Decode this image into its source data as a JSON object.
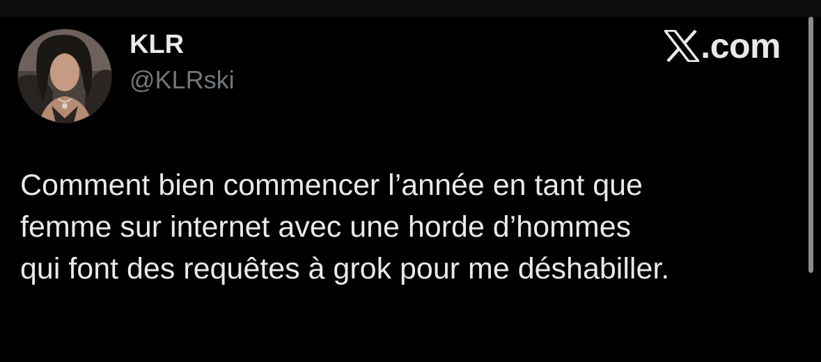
{
  "tweet": {
    "author": {
      "display_name": "KLR",
      "handle": "@KLRski",
      "avatar": "profile-photo"
    },
    "brand": {
      "icon": "x-logo-icon",
      "text": ".com"
    },
    "text": "Comment bien commencer l’année en tant que\nfemme sur internet avec une horde d’hommes\nqui font des requêtes à grok pour me déshabiller."
  },
  "colors": {
    "background": "#000000",
    "text_primary": "#e7e9ea",
    "text_secondary": "#71767b",
    "scrollbar": "#8b8b8b"
  }
}
